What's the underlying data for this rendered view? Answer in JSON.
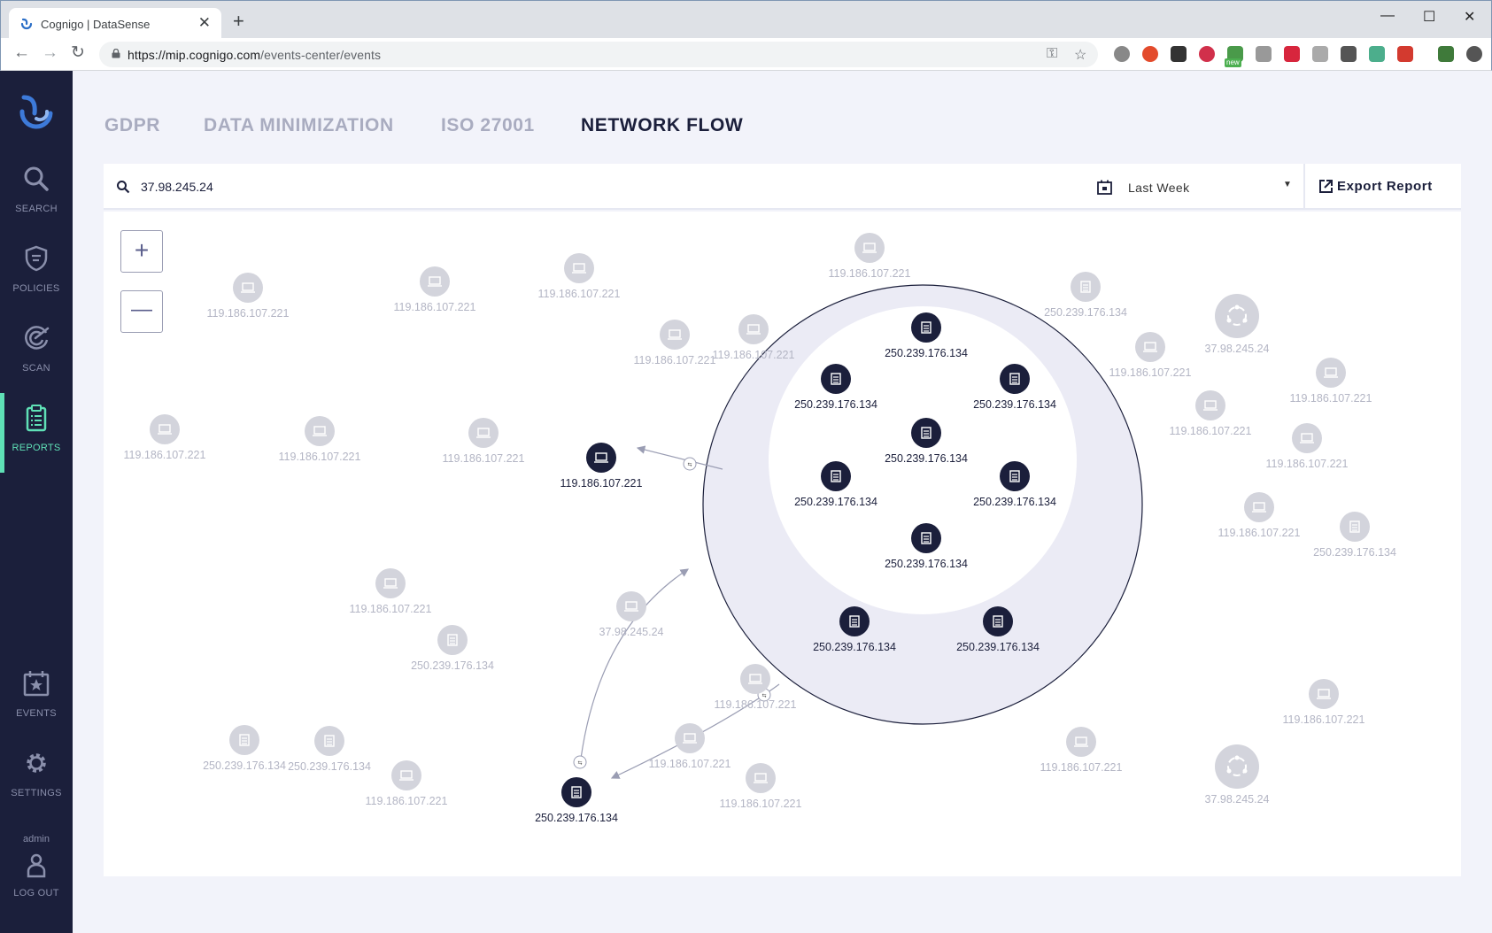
{
  "browser": {
    "tab_title": "Cognigo | DataSense",
    "tab_close": "✕",
    "new_tab": "+",
    "url_host": "https://mip.cognigo.com",
    "url_path": "/events-center/events",
    "window_controls": {
      "minimize": "—",
      "maximize": "☐",
      "close": "✕"
    },
    "extension_colors": [
      "#888888",
      "#e34b2c",
      "#333333",
      "#d1304b",
      "#4a9a4a",
      "#999999",
      "#d7263d",
      "#aaaaaa",
      "#555555",
      "#4cae8c",
      "#d33a2f",
      "#3f7a3a",
      "#555555"
    ],
    "new_badge": "new"
  },
  "sidebar": {
    "items": [
      {
        "label": "SEARCH",
        "icon": "search-icon",
        "active": false
      },
      {
        "label": "POLICIES",
        "icon": "shield-icon",
        "active": false
      },
      {
        "label": "SCAN",
        "icon": "radar-icon",
        "active": false
      },
      {
        "label": "REPORTS",
        "icon": "clipboard-icon",
        "active": true
      }
    ],
    "bottom_items": [
      {
        "label": "EVENTS",
        "icon": "calendar-star-icon"
      },
      {
        "label": "SETTINGS",
        "icon": "gear-icon"
      }
    ],
    "user": "admin",
    "logout": "LOG OUT"
  },
  "tabs": [
    {
      "label": "GDPR",
      "active": false
    },
    {
      "label": "DATA MINIMIZATION",
      "active": false
    },
    {
      "label": "ISO 27001",
      "active": false
    },
    {
      "label": "NETWORK FLOW",
      "active": true
    }
  ],
  "filter": {
    "search_value": "37.98.245.24",
    "date_range": "Last Week",
    "export_label": "Export Report"
  },
  "zoom": {
    "in": "+",
    "out": "—"
  },
  "colors": {
    "sidebar_bg": "#1b1f3b",
    "accent": "#5fe0b6",
    "node_dark": "#1b1f3b",
    "node_faded": "#d3d4dc",
    "cluster_fill": "#ebebf5"
  },
  "graph": {
    "nodes": [
      {
        "ip": "119.186.107.221",
        "type": "laptop",
        "state": "faded"
      },
      {
        "ip": "119.186.107.221",
        "type": "laptop",
        "state": "faded"
      },
      {
        "ip": "119.186.107.221",
        "type": "laptop",
        "state": "faded"
      },
      {
        "ip": "119.186.107.221",
        "type": "laptop",
        "state": "faded"
      },
      {
        "ip": "119.186.107.221",
        "type": "laptop",
        "state": "faded"
      },
      {
        "ip": "119.186.107.221",
        "type": "laptop",
        "state": "faded"
      },
      {
        "ip": "119.186.107.221",
        "type": "laptop",
        "state": "faded"
      },
      {
        "ip": "250.239.176.134",
        "type": "server",
        "state": "faded"
      },
      {
        "ip": "37.98.245.24",
        "type": "hub",
        "state": "faded"
      },
      {
        "ip": "119.186.107.221",
        "type": "laptop",
        "state": "faded"
      },
      {
        "ip": "119.186.107.221",
        "type": "laptop",
        "state": "faded"
      },
      {
        "ip": "119.186.107.221",
        "type": "laptop",
        "state": "faded"
      },
      {
        "ip": "119.186.107.221",
        "type": "laptop",
        "state": "faded"
      },
      {
        "ip": "119.186.107.221",
        "type": "laptop",
        "state": "faded"
      },
      {
        "ip": "250.239.176.134",
        "type": "server",
        "state": "faded"
      },
      {
        "ip": "119.186.107.221",
        "type": "laptop",
        "state": "faded"
      },
      {
        "ip": "119.186.107.221",
        "type": "laptop",
        "state": "active"
      },
      {
        "ip": "119.186.107.221",
        "type": "laptop",
        "state": "faded"
      },
      {
        "ip": "119.186.107.221",
        "type": "laptop",
        "state": "faded"
      },
      {
        "ip": "37.98.245.24",
        "type": "laptop",
        "state": "faded"
      },
      {
        "ip": "250.239.176.134",
        "type": "server",
        "state": "faded"
      },
      {
        "ip": "119.186.107.221",
        "type": "laptop",
        "state": "faded"
      },
      {
        "ip": "250.239.176.134",
        "type": "server",
        "state": "faded"
      },
      {
        "ip": "119.186.107.221",
        "type": "laptop",
        "state": "faded"
      },
      {
        "ip": "119.186.107.221",
        "type": "laptop",
        "state": "faded"
      },
      {
        "ip": "250.239.176.134",
        "type": "server",
        "state": "active"
      },
      {
        "ip": "119.186.107.221",
        "type": "laptop",
        "state": "faded"
      },
      {
        "ip": "119.186.107.221",
        "type": "laptop",
        "state": "faded"
      },
      {
        "ip": "250.239.176.134",
        "type": "server",
        "state": "faded"
      },
      {
        "ip": "119.186.107.221",
        "type": "laptop",
        "state": "faded"
      },
      {
        "ip": "37.98.245.24",
        "type": "hub",
        "state": "faded"
      }
    ],
    "cluster_nodes": [
      {
        "ip": "250.239.176.134",
        "type": "server"
      },
      {
        "ip": "250.239.176.134",
        "type": "server"
      },
      {
        "ip": "250.239.176.134",
        "type": "server"
      },
      {
        "ip": "250.239.176.134",
        "type": "server"
      },
      {
        "ip": "250.239.176.134",
        "type": "server"
      },
      {
        "ip": "250.239.176.134",
        "type": "server"
      },
      {
        "ip": "250.239.176.134",
        "type": "server"
      },
      {
        "ip": "250.239.176.134",
        "type": "server"
      },
      {
        "ip": "250.239.176.134",
        "type": "server"
      },
      {
        "ip": "250.239.176.134",
        "type": "server"
      }
    ]
  }
}
